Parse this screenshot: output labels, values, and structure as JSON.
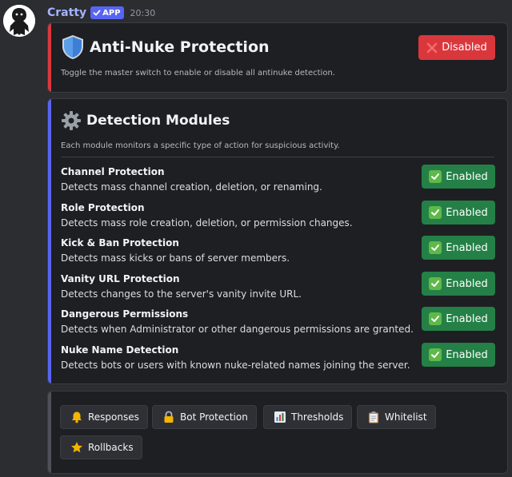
{
  "message": {
    "username": "Cratty",
    "app_badge": "APP",
    "timestamp": "20:30"
  },
  "master_card": {
    "title": "Anti-Nuke Protection",
    "description": "Toggle the master switch to enable or disable all antinuke detection.",
    "status_label": "Disabled",
    "accent_color": "#da373c"
  },
  "modules_card": {
    "title": "Detection Modules",
    "description": "Each module monitors a specific type of action for suspicious activity.",
    "accent_color": "#5865f2",
    "modules": [
      {
        "name": "Channel Protection",
        "description": "Detects mass channel creation, deletion, or renaming.",
        "status": "Enabled"
      },
      {
        "name": "Role Protection",
        "description": "Detects mass role creation, deletion, or permission changes.",
        "status": "Enabled"
      },
      {
        "name": "Kick & Ban Protection",
        "description": "Detects mass kicks or bans of server members.",
        "status": "Enabled"
      },
      {
        "name": "Vanity URL Protection",
        "description": "Detects changes to the server's vanity invite URL.",
        "status": "Enabled"
      },
      {
        "name": "Dangerous Permissions",
        "description": "Detects when Administrator or other dangerous permissions are granted.",
        "status": "Enabled"
      },
      {
        "name": "Nuke Name Detection",
        "description": "Detects bots or users with known nuke-related names joining the server.",
        "status": "Enabled"
      }
    ]
  },
  "nav_card": {
    "accent_color": "#4e5058",
    "buttons": [
      {
        "label": "Responses",
        "icon": "bell-icon"
      },
      {
        "label": "Bot Protection",
        "icon": "lock-icon"
      },
      {
        "label": "Thresholds",
        "icon": "bar-chart-icon"
      },
      {
        "label": "Whitelist",
        "icon": "clipboard-icon"
      },
      {
        "label": "Rollbacks",
        "icon": "star-icon"
      }
    ]
  },
  "colors": {
    "enabled_green": "#248046",
    "disabled_red": "#da373c",
    "blurple": "#5865f2"
  }
}
